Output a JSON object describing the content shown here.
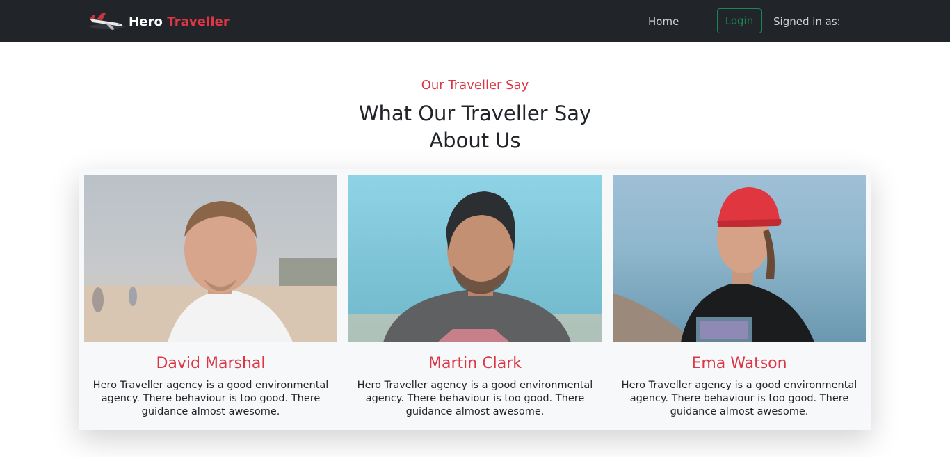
{
  "navbar": {
    "brand_first": "Hero",
    "brand_second": "Traveller",
    "home_label": "Home",
    "login_label": "Login",
    "signed_in_label": "Signed in as:"
  },
  "testimonials": {
    "eyebrow": "Our Traveller Say",
    "title_line1": "What Our Traveller Say",
    "title_line2": "About Us",
    "cards": [
      {
        "name": "David Marshal",
        "quote": "Hero Traveller agency is a good environmental agency. There behaviour is too good. There guidance almost awesome."
      },
      {
        "name": "Martin Clark",
        "quote": "Hero Traveller agency is a good environmental agency. There behaviour is too good. There guidance almost awesome."
      },
      {
        "name": "Ema Watson",
        "quote": "Hero Traveller agency is a good environmental agency. There behaviour is too good. There guidance almost awesome."
      }
    ]
  },
  "colors": {
    "accent_red": "#dc3545",
    "navbar_bg": "#212529",
    "login_green": "#198754"
  },
  "icons": [
    "airplane-logo-icon"
  ]
}
